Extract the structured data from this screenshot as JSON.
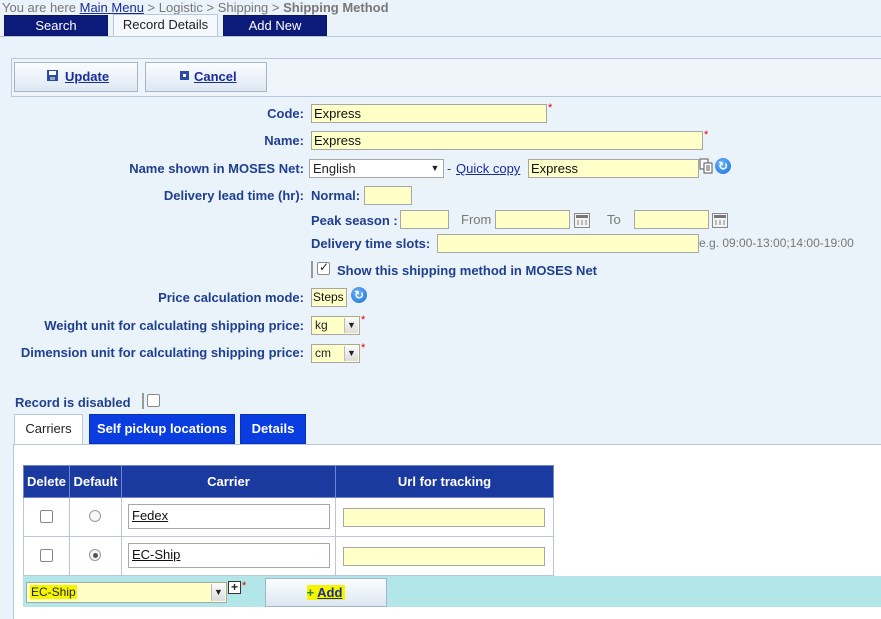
{
  "breadcrumb": {
    "prefix": "You are here",
    "main_menu": "Main Menu",
    "sep1": ">",
    "logistic": "Logistic",
    "sep2": ">",
    "shipping": "Shipping",
    "sep3": ">",
    "current": "Shipping Method"
  },
  "tabs": {
    "search": "Search",
    "record_details": "Record Details",
    "add_new": "Add New"
  },
  "toolbar": {
    "update": "Update",
    "cancel": "Cancel"
  },
  "form": {
    "code_label": "Code:",
    "code_value": "Express",
    "name_label": "Name:",
    "name_value": "Express",
    "moses_label": "Name shown in MOSES Net:",
    "language_value": "English",
    "dash": "-",
    "quick_copy": "Quick copy",
    "moses_value": "Express",
    "lead_time_label": "Delivery lead time (hr):",
    "normal_label": "Normal:",
    "normal_value": "",
    "peak_label": "Peak season :",
    "peak_value": "",
    "from_label": "From",
    "from_value": "",
    "to_label": "To",
    "to_value": "",
    "slots_label": "Delivery time slots:",
    "slots_value": "",
    "slots_hint": "e.g. 09:00-13:00;14:00-19:00",
    "show_label": "Show this shipping method in MOSES Net",
    "show_checked": true,
    "price_mode_label": "Price calculation mode:",
    "price_mode_value": "Steps",
    "weight_label": "Weight unit for calculating shipping price:",
    "weight_value": "kg",
    "dimension_label": "Dimension unit for calculating shipping price:",
    "dimension_value": "cm",
    "disabled_label": "Record is disabled",
    "disabled_checked": false,
    "required_mark": "*"
  },
  "subtabs": {
    "carriers": "Carriers",
    "self_pickup": "Self pickup locations",
    "details": "Details"
  },
  "carriers_table": {
    "headers": [
      "Delete",
      "Default",
      "Carrier",
      "Url for tracking"
    ],
    "rows": [
      {
        "carrier": "Fedex",
        "url": "",
        "default": false,
        "delete": false
      },
      {
        "carrier": "EC-Ship",
        "url": "",
        "default": true,
        "delete": false
      }
    ]
  },
  "add_row": {
    "selected_carrier": "EC-Ship",
    "add_label": "Add",
    "plus": "+"
  },
  "colors": {
    "dark_tab": "#0c1a7a",
    "blue_tab": "#0a3de0",
    "grid_header": "#1b3aa0",
    "required": "#dd0000",
    "input_bg": "#ffffc8",
    "add_row_bg": "#b2e6e8",
    "highlight": "#f5f500"
  }
}
